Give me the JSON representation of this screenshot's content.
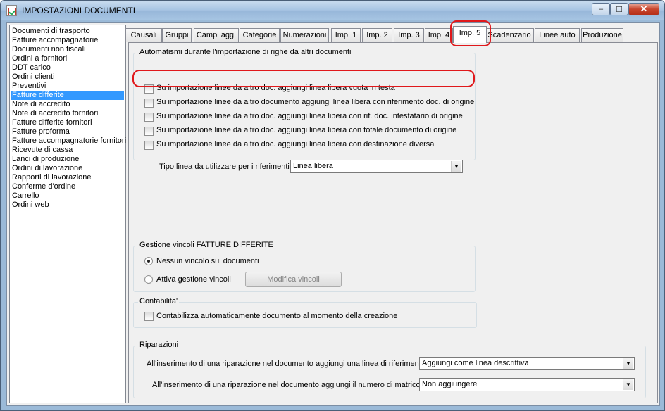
{
  "window": {
    "title": "IMPOSTAZIONI DOCUMENTI",
    "min_glyph": "–",
    "max_glyph": "☐",
    "close_glyph": "✕"
  },
  "sidebar": {
    "items": [
      {
        "label": "Documenti di trasporto",
        "selected": false
      },
      {
        "label": "Fatture accompagnatorie",
        "selected": false
      },
      {
        "label": "Documenti non fiscali",
        "selected": false
      },
      {
        "label": "Ordini a fornitori",
        "selected": false
      },
      {
        "label": "DDT carico",
        "selected": false
      },
      {
        "label": "Ordini clienti",
        "selected": false
      },
      {
        "label": "Preventivi",
        "selected": false
      },
      {
        "label": "Fatture differite",
        "selected": true
      },
      {
        "label": "Note di accredito",
        "selected": false
      },
      {
        "label": "Note di accredito fornitori",
        "selected": false
      },
      {
        "label": "Fatture differite fornitori",
        "selected": false
      },
      {
        "label": "Fatture proforma",
        "selected": false
      },
      {
        "label": "Fatture accompagnatorie fornitori",
        "selected": false
      },
      {
        "label": "Ricevute di cassa",
        "selected": false
      },
      {
        "label": "Lanci di produzione",
        "selected": false
      },
      {
        "label": "Ordini di lavorazione",
        "selected": false
      },
      {
        "label": "Rapporti di lavorazione",
        "selected": false
      },
      {
        "label": "Conferme d'ordine",
        "selected": false
      },
      {
        "label": "Carrello",
        "selected": false
      },
      {
        "label": "Ordini web",
        "selected": false
      }
    ]
  },
  "tabs": [
    "Causali",
    "Gruppi",
    "Campi agg.",
    "Categorie",
    "Numerazioni",
    "Imp. 1",
    "Imp. 2",
    "Imp. 3",
    "Imp. 4",
    "Imp. 5",
    "Scadenzario",
    "Linee auto",
    "Produzione"
  ],
  "active_tab": "Imp. 5",
  "automatismi": {
    "title": "Automatismi durante l'importazione di righe da altri documenti",
    "options": [
      {
        "label": "Su importazione linee da altro doc. aggiungi linea libera vuota in testa",
        "checked": false
      },
      {
        "label": "Su importazione linee da altro documento aggiungi linea libera con riferimento doc. di origine",
        "checked": false
      },
      {
        "label": "Su importazione linee da altro doc. aggiungi linea libera con rif. doc. intestatario di origine",
        "checked": false
      },
      {
        "label": "Su importazione linee da altro doc. aggiungi linea libera con totale documento di origine",
        "checked": false
      },
      {
        "label": "Su importazione linee da altro doc. aggiungi linea libera con destinazione diversa",
        "checked": false
      }
    ],
    "tipo_linea_label": "Tipo linea da utilizzare per i riferimenti :",
    "tipo_linea_value": "Linea libera"
  },
  "vincoli": {
    "title": "Gestione vincoli FATTURE DIFFERITE",
    "radio_none": "Nessun vincolo sui documenti",
    "radio_attiva": "Attiva gestione vincoli",
    "selected": "none",
    "button": "Modifica vincoli"
  },
  "contabilita": {
    "title": "Contabilita'",
    "checkbox_label": "Contabilizza automaticamente documento al momento della creazione",
    "checked": false
  },
  "riparazioni": {
    "title": "Riparazioni",
    "row1_label": "All'inserimento di una riparazione nel documento aggiungi una linea di riferimento :",
    "row1_value": "Aggiungi come linea descrittiva",
    "row2_label": "All'inserimento di una riparazione nel documento aggiungi il numero di matricola :",
    "row2_value": "Non aggiungere"
  },
  "colors": {
    "selection": "#3399ff",
    "highlight": "#e0181b",
    "titlebar": "#a9c6e4"
  }
}
